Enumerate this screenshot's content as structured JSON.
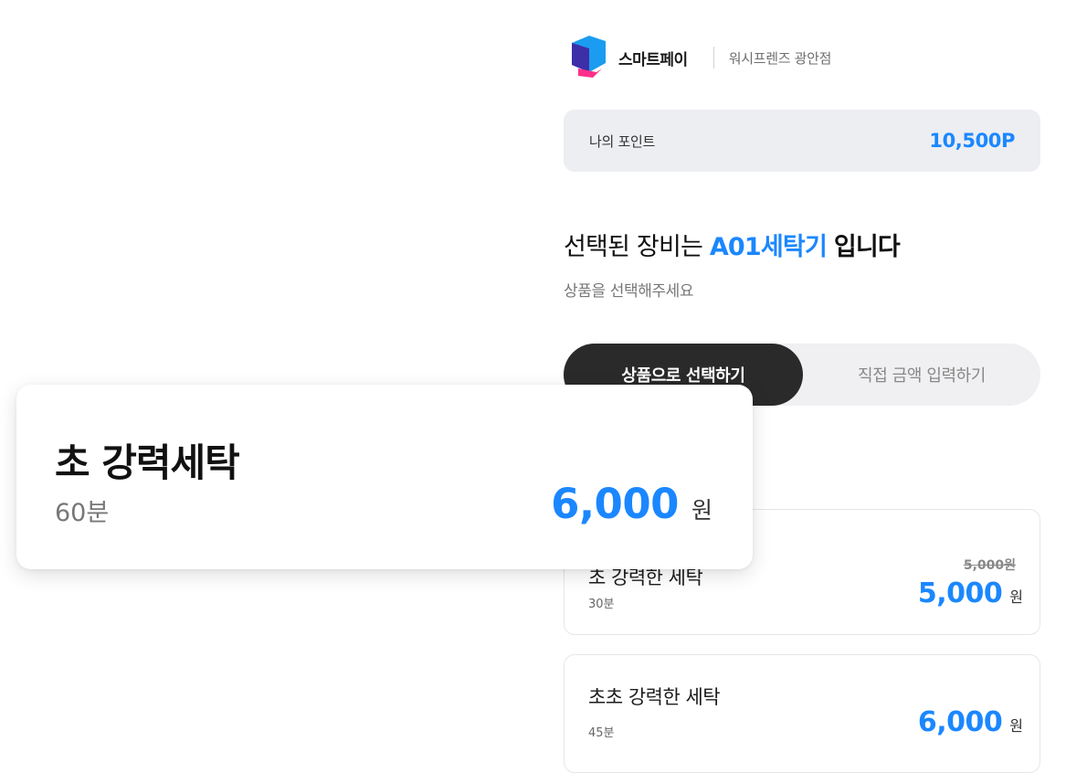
{
  "header": {
    "brand": "스마트페이",
    "store": "워시프렌즈 광안점",
    "logo_colors": [
      "#3d2fa8",
      "#1b9cf0",
      "#ff2e8a"
    ]
  },
  "points": {
    "label": "나의 포인트",
    "value": "10,500P"
  },
  "selection": {
    "heading_prefix": "선택된 장비는",
    "machine": "A01세탁기",
    "heading_suffix": "입니다",
    "subtext": "상품을 선택해주세요"
  },
  "segment": {
    "active": "상품으로 선택하기",
    "inactive": "직접 금액 입력하기"
  },
  "products": [
    {
      "name": "초 강력한 세탁",
      "duration": "30분",
      "original_price": "5,000원",
      "price": "5,000",
      "unit": "원"
    },
    {
      "name": "초초 강력한 세탁",
      "duration": "45분",
      "price": "6,000",
      "unit": "원"
    }
  ],
  "featured": {
    "name": "초 강력세탁",
    "duration": "60분",
    "price": "6,000",
    "unit": "원"
  },
  "colors": {
    "accent": "#1b87ff",
    "dark": "#2a2a2a",
    "panel": "#eceef2"
  }
}
